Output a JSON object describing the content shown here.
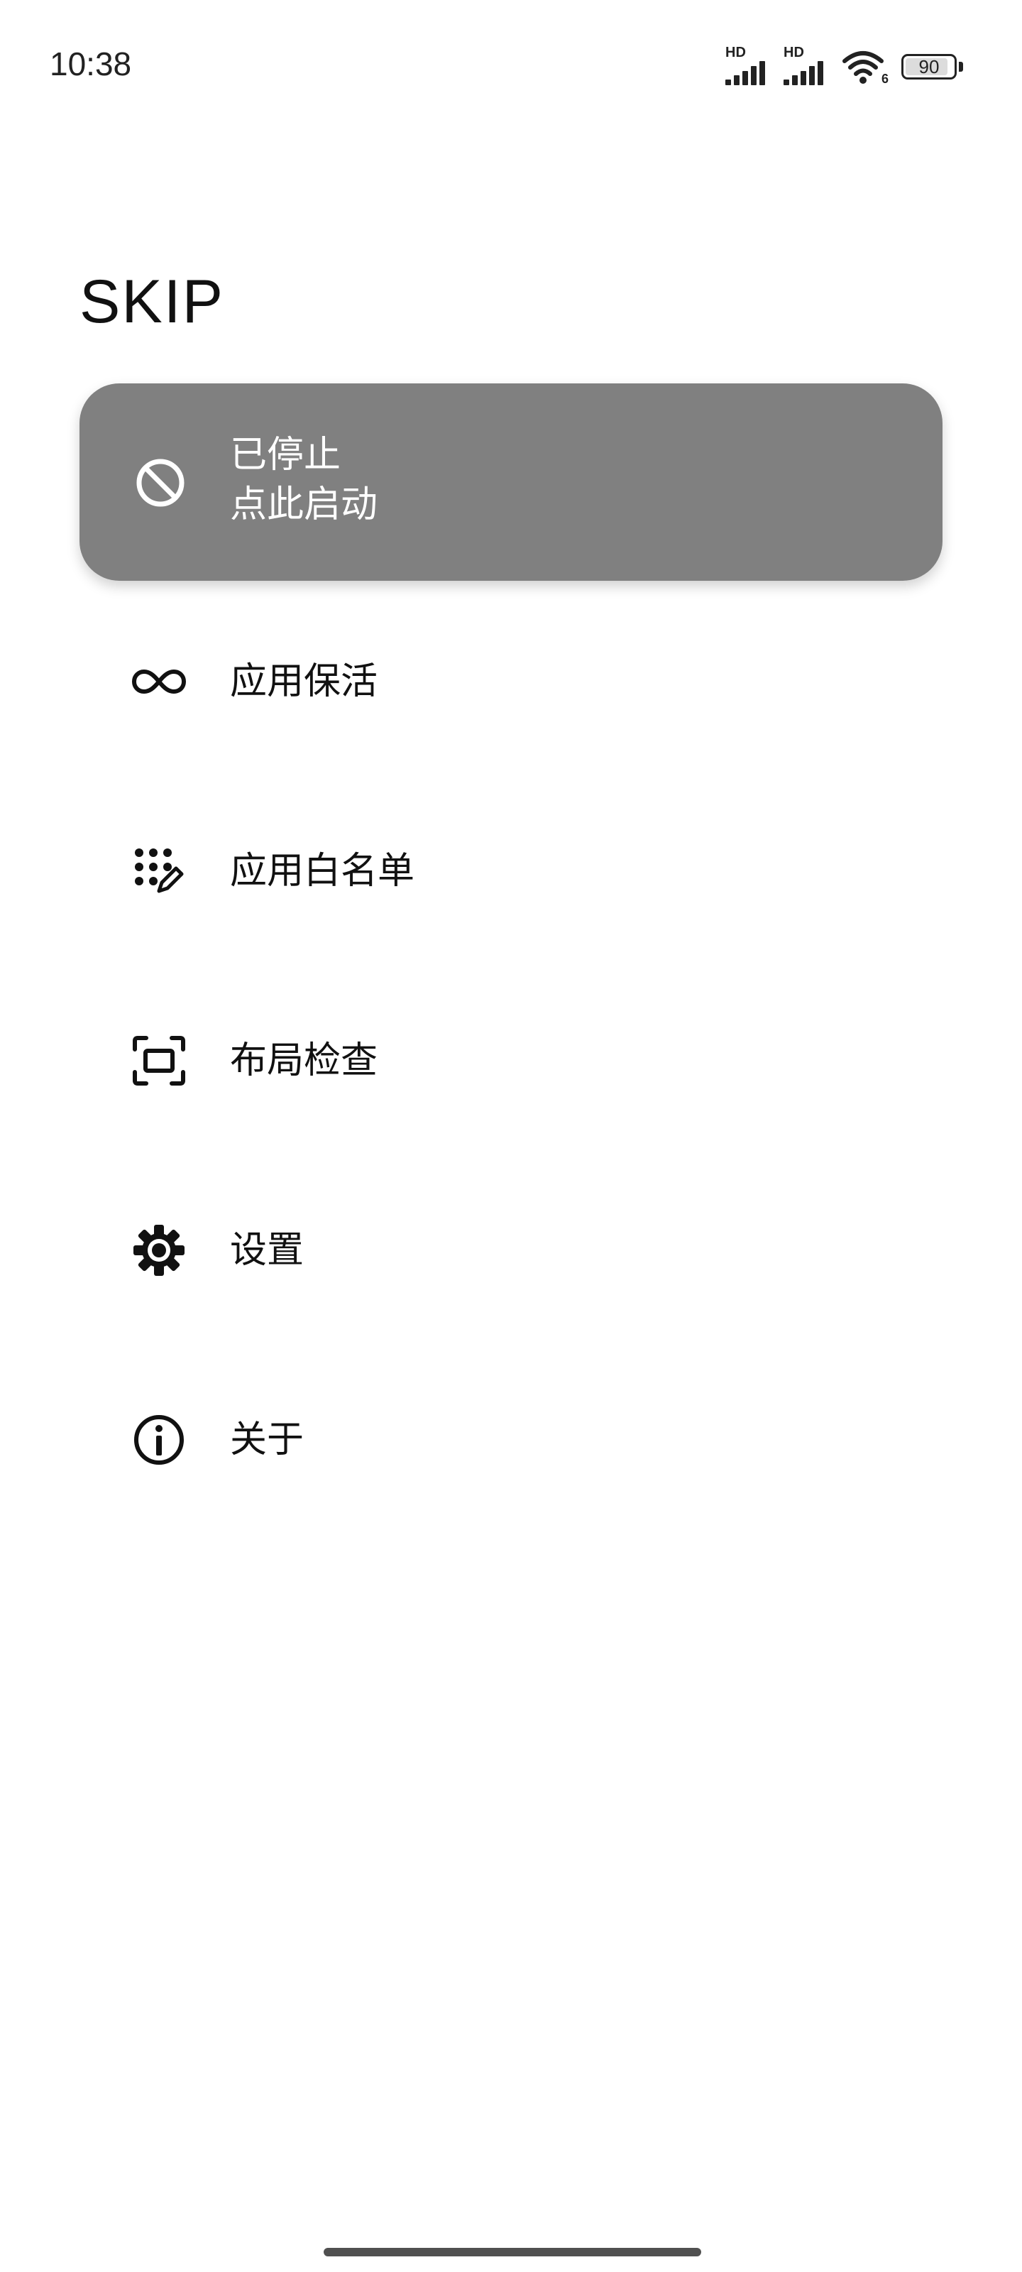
{
  "status_bar": {
    "time": "10:38",
    "signal_1_label": "HD",
    "signal_2_label": "HD",
    "wifi_badge": "6",
    "battery_level": "90",
    "battery_fraction": 0.9
  },
  "app": {
    "title": "SKIP"
  },
  "status_card": {
    "icon": "block-icon",
    "line1": "已停止",
    "line2": "点此启动",
    "background": "#808080"
  },
  "menu": {
    "items": [
      {
        "id": "keep-alive",
        "icon": "infinity-icon",
        "label": "应用保活"
      },
      {
        "id": "whitelist",
        "icon": "dots-edit-icon",
        "label": "应用白名单"
      },
      {
        "id": "layout-inspect",
        "icon": "screen-frame-icon",
        "label": "布局检查"
      },
      {
        "id": "settings",
        "icon": "gear-icon",
        "label": "设置"
      },
      {
        "id": "about",
        "icon": "info-icon",
        "label": "关于"
      }
    ]
  }
}
